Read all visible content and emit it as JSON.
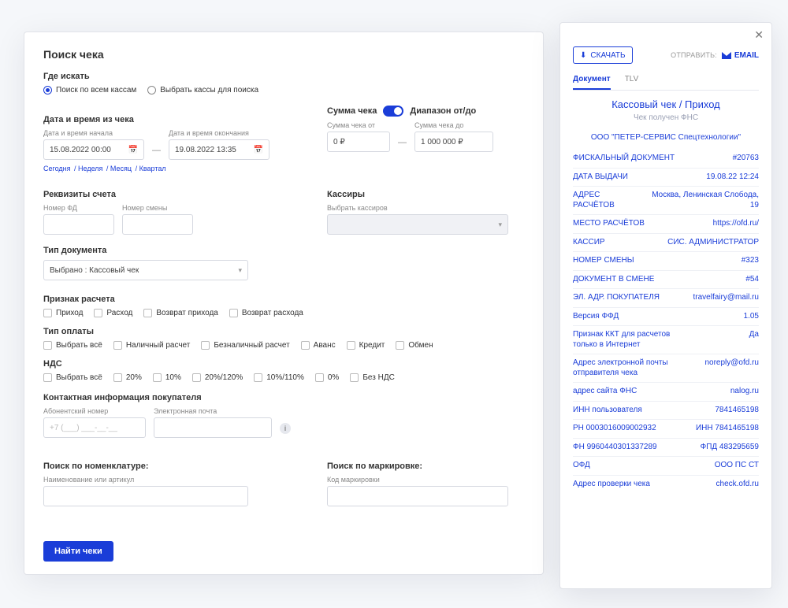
{
  "search": {
    "title": "Поиск чека",
    "where": {
      "label": "Где искать",
      "opt_all": "Поиск по всем кассам",
      "opt_pick": "Выбрать кассы для поиска"
    },
    "datetime": {
      "label": "Дата и время из чека",
      "start_label": "Дата и время начала",
      "end_label": "Дата и время окончания",
      "start_value": "15.08.2022 00:00",
      "end_value": "19.08.2022 13:35",
      "quick_today": "Сегодня",
      "quick_week": "Неделя",
      "quick_month": "Месяц",
      "quick_quarter": "Квартал"
    },
    "sum": {
      "label": "Сумма чека",
      "range_label": "Диапазон от/до",
      "from_label": "Сумма чека от",
      "to_label": "Сумма чека до",
      "from_value": "0 ₽",
      "to_value": "1 000 000 ₽"
    },
    "account": {
      "label": "Реквизиты счета",
      "fd_label": "Номер ФД",
      "shift_label": "Номер смены"
    },
    "cashiers": {
      "label": "Кассиры",
      "placeholder": "Выбрать кассиров"
    },
    "doctype": {
      "label": "Тип документа",
      "value": "Выбрано : Кассовый чек"
    },
    "calc_sign": {
      "label": "Признак расчета",
      "opts": [
        "Приход",
        "Расход",
        "Возврат прихода",
        "Возврат расхода"
      ]
    },
    "pay_type": {
      "label": "Тип оплаты",
      "opts": [
        "Выбрать всё",
        "Наличный расчет",
        "Безналичный расчет",
        "Аванс",
        "Кредит",
        "Обмен"
      ]
    },
    "vat": {
      "label": "НДС",
      "opts": [
        "Выбрать всё",
        "20%",
        "10%",
        "20%/120%",
        "10%/110%",
        "0%",
        "Без НДС"
      ]
    },
    "buyer": {
      "label": "Контактная информация покупателя",
      "phone_label": "Абонентский номер",
      "phone_value": "+7 (___) ___-__-__",
      "email_label": "Электронная почта"
    },
    "by_nomenclature": {
      "label": "Поиск по номенклатуре:",
      "input_label": "Наименование или артикул"
    },
    "by_marking": {
      "label": "Поиск по маркировке:",
      "input_label": "Код маркировки"
    },
    "submit": "Найти чеки"
  },
  "receipt": {
    "download": "СКАЧАТЬ",
    "send_label": "ОТПРАВИТЬ:",
    "email": "EMAIL",
    "tab_doc": "Документ",
    "tab_tlv": "TLV",
    "title": "Кассовый чек / Приход",
    "subtitle": "Чек получен ФНС",
    "company": "ООО \"ПЕТЕР-СЕРВИС Спецтехнологии\"",
    "rows": [
      {
        "k": "ФИСКАЛЬНЫЙ ДОКУМЕНТ",
        "v": "#20763"
      },
      {
        "k": "ДАТА ВЫДАЧИ",
        "v": "19.08.22 12:24"
      },
      {
        "k": "АДРЕС РАСЧЁТОВ",
        "v": "Москва, Ленинская Слобода, 19"
      },
      {
        "k": "МЕСТО РАСЧЁТОВ",
        "v": "https://ofd.ru/"
      },
      {
        "k": "КАССИР",
        "v": "СИС. АДМИНИСТРАТОР"
      },
      {
        "k": "НОМЕР СМЕНЫ",
        "v": "#323"
      },
      {
        "k": "ДОКУМЕНТ В СМЕНЕ",
        "v": "#54"
      },
      {
        "k": "ЭЛ. АДР. ПОКУПАТЕЛЯ",
        "v": "travelfairy@mail.ru"
      },
      {
        "k": "Версия ФФД",
        "v": "1.05"
      },
      {
        "k": "Признак ККТ для расчетов только в Интернет",
        "v": "Да"
      },
      {
        "k": "Адрес электронной почты отправителя чека",
        "v": "noreply@ofd.ru"
      },
      {
        "k": "адрес сайта ФНС",
        "v": "nalog.ru"
      },
      {
        "k": "ИНН пользователя",
        "v": "7841465198"
      },
      {
        "k": "РН 0003016009002932",
        "v": "ИНН 7841465198"
      },
      {
        "k": "ФН 9960440301337289",
        "v": "ФПД 483295659"
      },
      {
        "k": "ОФД",
        "v": "ООО ПС СТ"
      },
      {
        "k": "Адрес проверки чека",
        "v": "check.ofd.ru"
      }
    ]
  }
}
